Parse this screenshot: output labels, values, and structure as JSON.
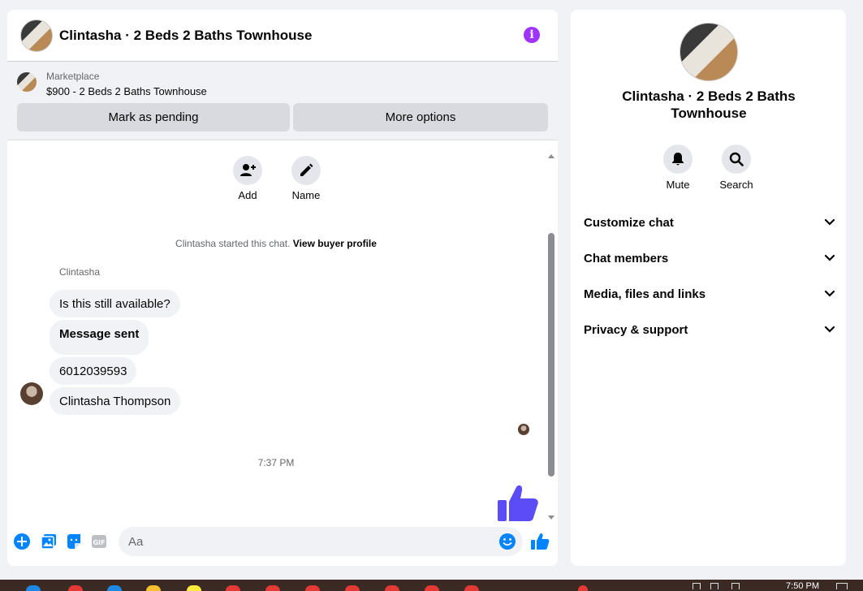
{
  "header": {
    "title": "Clintasha · 2 Beds 2 Baths Townhouse",
    "info_icon": "info-icon",
    "accent_color": "#a033ff"
  },
  "marketplace": {
    "label": "Marketplace",
    "item": "$900 - 2 Beds 2 Baths Townhouse",
    "buttons": {
      "mark_pending": "Mark as pending",
      "more_options": "More options"
    }
  },
  "chat_actions": [
    {
      "label": "Add",
      "icon": "add-person-icon"
    },
    {
      "label": "Name",
      "icon": "pencil-icon"
    }
  ],
  "messages": {
    "system_prefix": "Clintasha started this chat.",
    "system_link": "View buyer profile",
    "sender": "Clintasha",
    "items": [
      {
        "text": "Is this still available?",
        "bold": false
      },
      {
        "text": "Message sent",
        "bold": true
      },
      {
        "text": "6012039593",
        "bold": false
      },
      {
        "text": "Clintasha Thompson",
        "bold": false
      }
    ],
    "timestamp": "7:37 PM"
  },
  "composer": {
    "placeholder": "Aa",
    "value": "",
    "icons": [
      "plus-circle-icon",
      "image-icon",
      "sticker-icon",
      "gif-icon",
      "emoji-icon",
      "like-icon"
    ],
    "icon_color": "#0084ff"
  },
  "info_panel": {
    "title": "Clintasha · 2 Beds 2 Baths Townhouse",
    "actions": [
      {
        "label": "Mute",
        "icon": "bell-icon"
      },
      {
        "label": "Search",
        "icon": "search-icon"
      }
    ],
    "sections": [
      "Customize chat",
      "Chat members",
      "Media, files and links",
      "Privacy & support"
    ]
  },
  "taskbar": {
    "time": "7:50 PM"
  },
  "colors": {
    "like_big": "#5b4cf5",
    "bubble_bg": "#f0f2f5",
    "button_bg": "#d8dadf"
  }
}
